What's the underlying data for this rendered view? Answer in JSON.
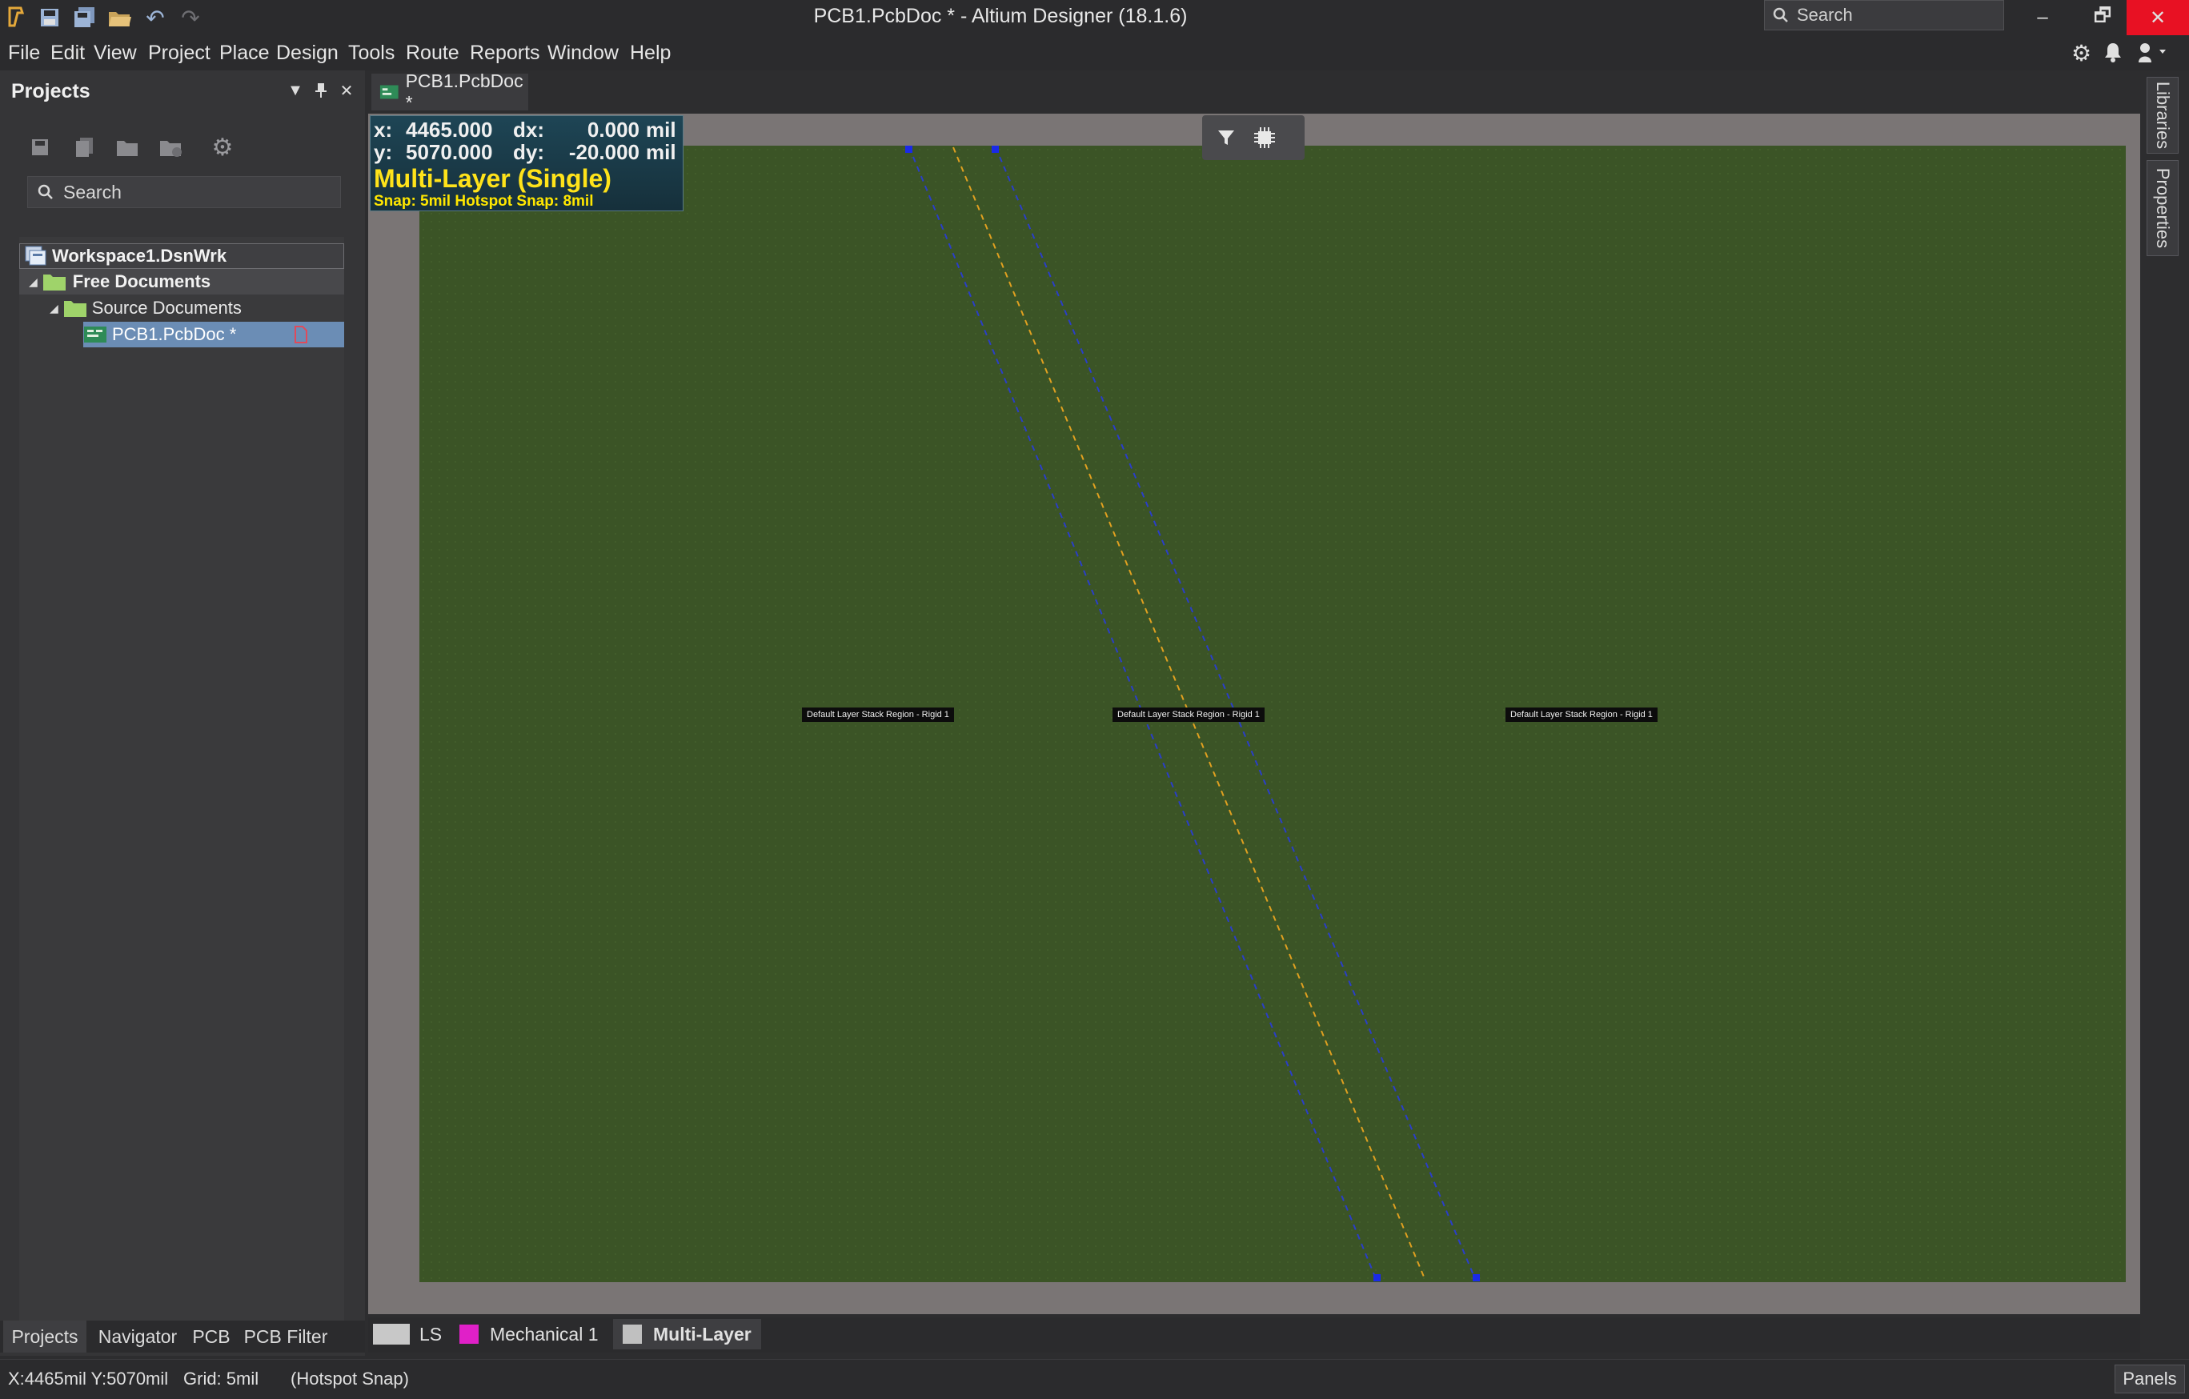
{
  "window": {
    "title": "PCB1.PcbDoc * - Altium Designer (18.1.6)",
    "search_placeholder": "Search",
    "controls": {
      "minimize": "‒",
      "maximize": "🗗",
      "close": "✕"
    }
  },
  "menu": [
    "File",
    "Edit",
    "View",
    "Project",
    "Place",
    "Design",
    "Tools",
    "Route",
    "Reports",
    "Window",
    "Help"
  ],
  "projects_panel": {
    "title": "Projects",
    "search_placeholder": "Search",
    "tree": {
      "workspace": "Workspace1.DsnWrk",
      "free_documents": "Free Documents",
      "source_documents": "Source Documents",
      "pcb_doc": "PCB1.PcbDoc *"
    },
    "bottom_tabs": [
      "Projects",
      "Navigator",
      "PCB",
      "PCB Filter"
    ]
  },
  "document_tab": {
    "label": "PCB1.PcbDoc *"
  },
  "editor": {
    "coords": {
      "x_label": "x:",
      "x_value": "4465.000",
      "dx_label": "dx:",
      "dx_value": "0.000",
      "x_unit": "mil",
      "y_label": "y:",
      "y_value": "5070.000",
      "dy_label": "dy:",
      "dy_value": "-20.000",
      "y_unit": "mil"
    },
    "layer_name": "Multi-Layer (Single)",
    "snap_info": "Snap: 5mil Hotspot Snap: 8mil",
    "region_labels": [
      "Default Layer Stack Region - Rigid 1",
      "Default Layer Stack Region - Rigid 1",
      "Default Layer Stack Region - Rigid 1"
    ]
  },
  "side_tabs": [
    "Libraries",
    "Properties"
  ],
  "layer_tabs": {
    "ls": {
      "label": "LS",
      "color": "#c8c8c8"
    },
    "mechanical": {
      "label": "Mechanical 1",
      "color": "#e020c8"
    },
    "multilayer": {
      "label": "Multi-Layer",
      "color": "#c0c0c0"
    }
  },
  "statusbar": {
    "coords": "X:4465mil Y:5070mil",
    "grid": "Grid: 5mil",
    "snap": "(Hotspot Snap)",
    "panels_button": "Panels"
  },
  "colors": {
    "board": "#3b5426",
    "board_border": "#7a7575",
    "selection": "#6b8db5",
    "close_button": "#e81123",
    "layer_text": "#ffe31a"
  }
}
